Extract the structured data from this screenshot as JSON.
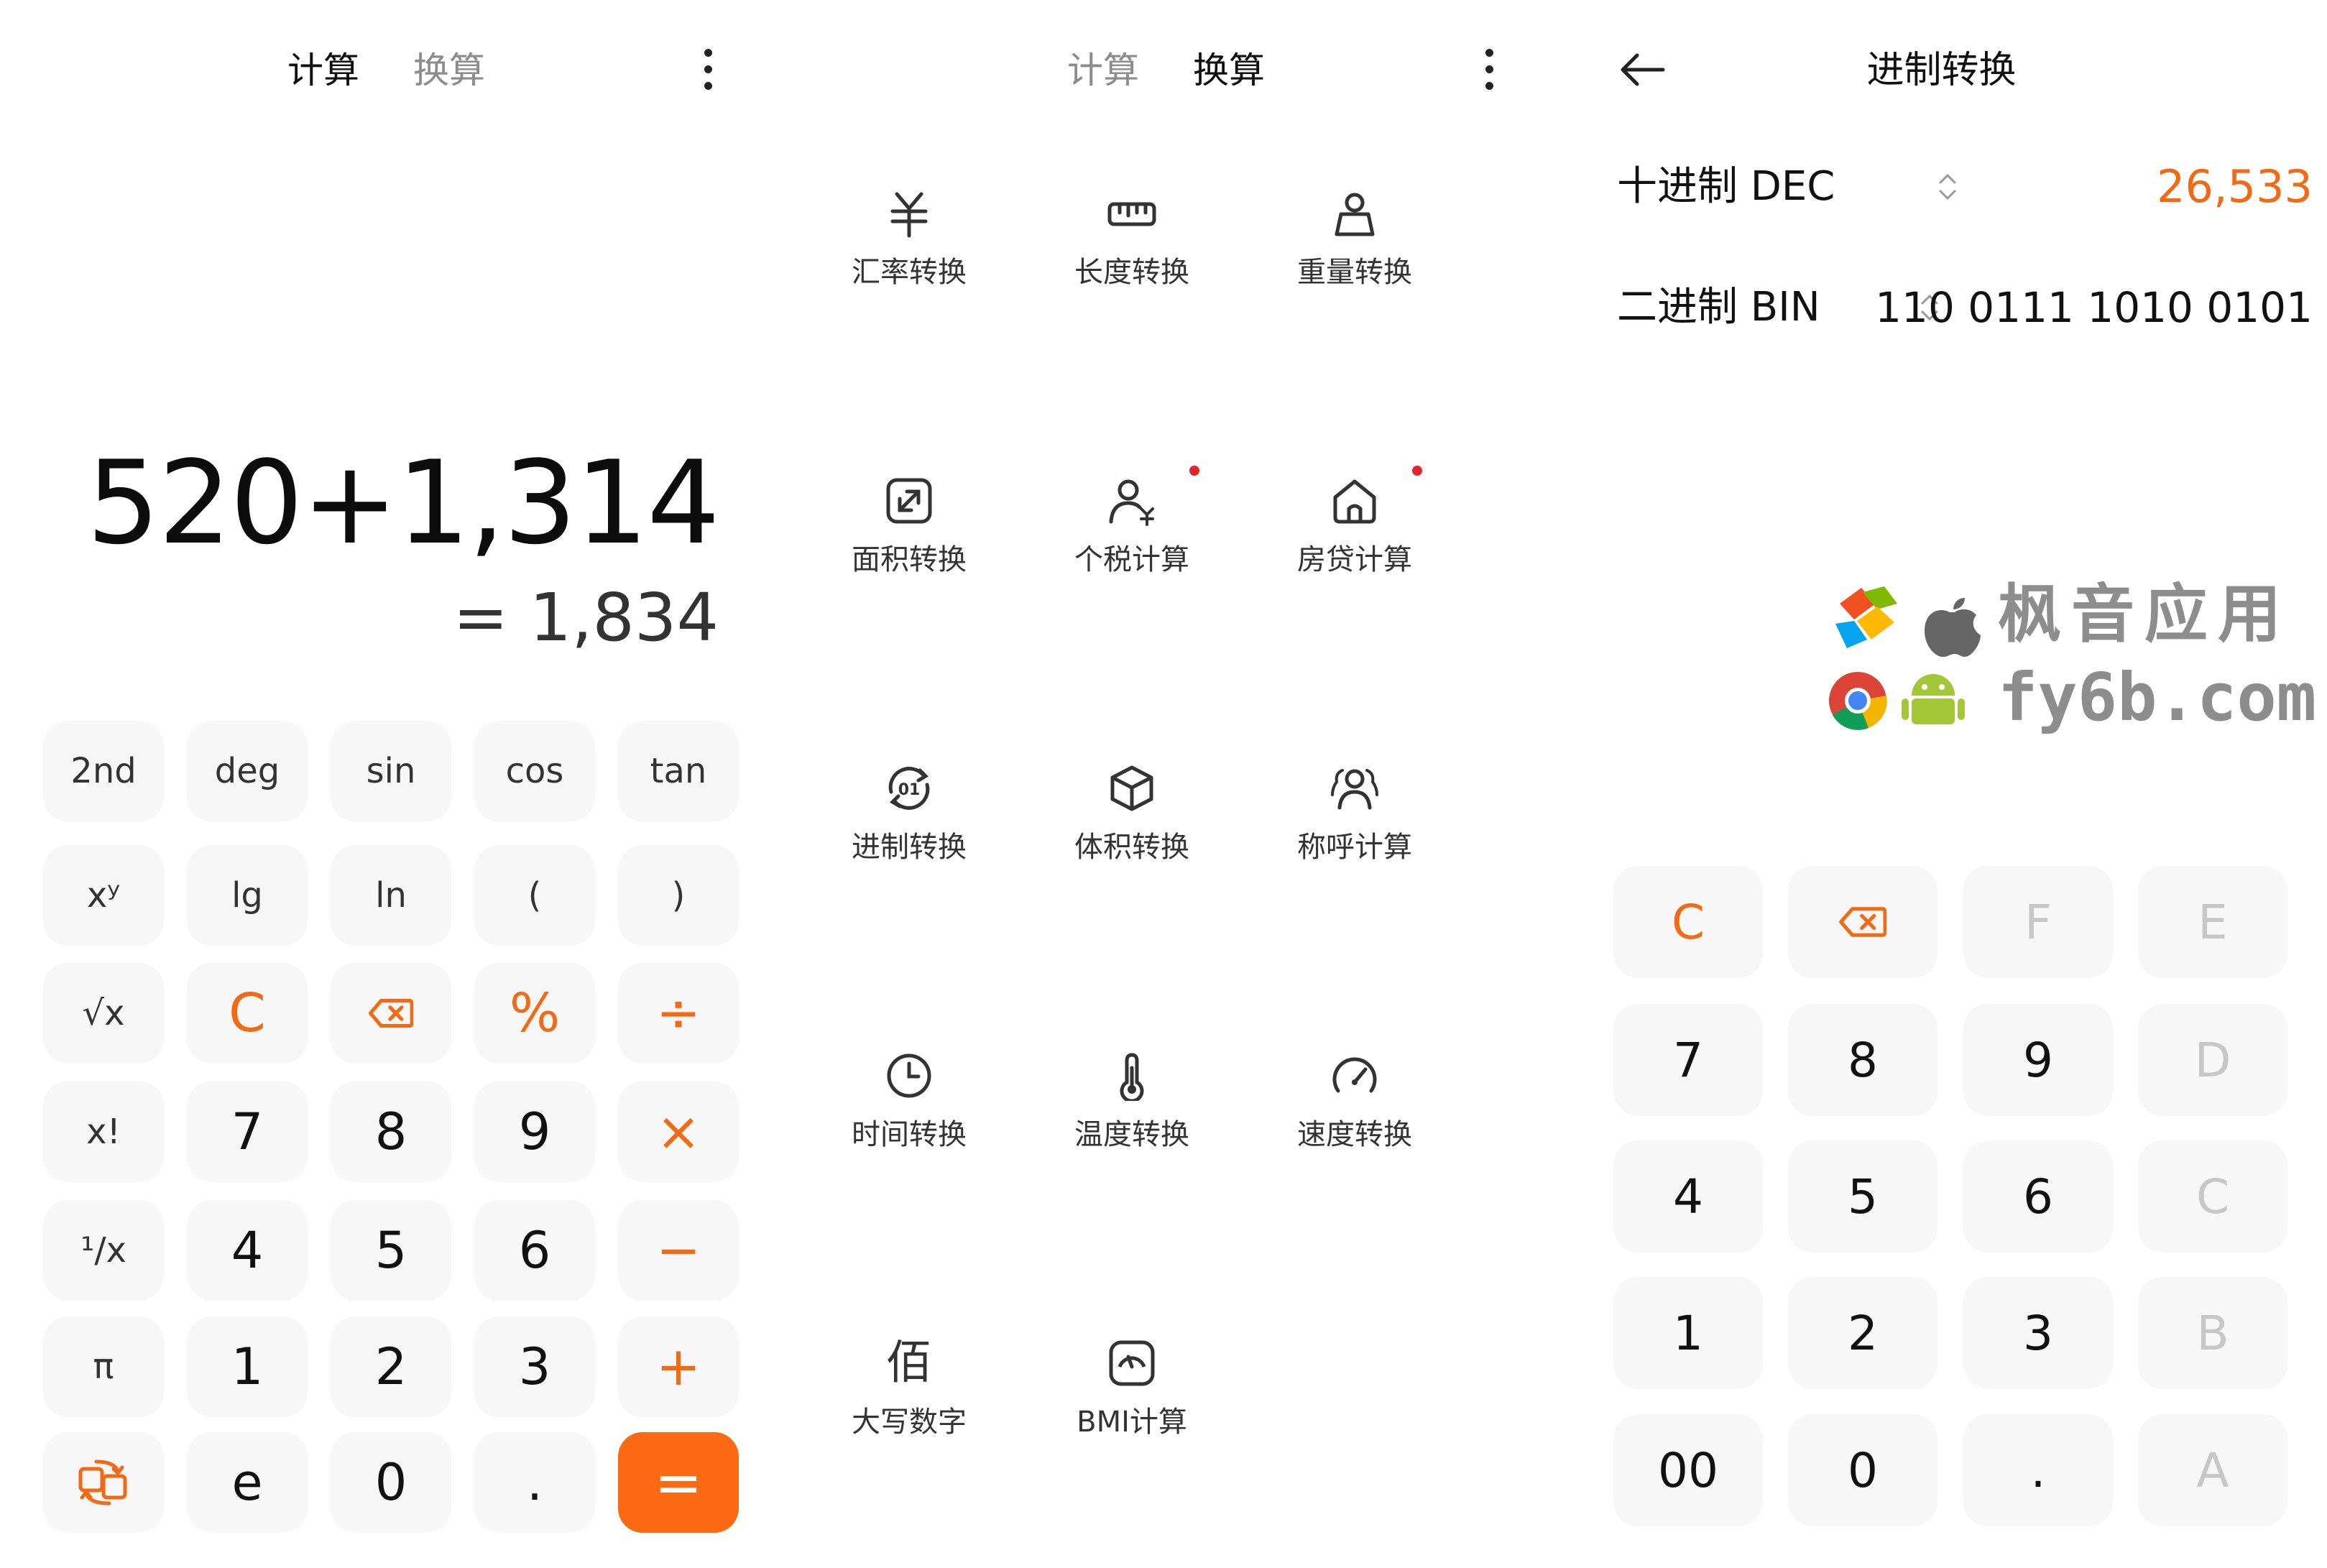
{
  "calc": {
    "tabs": [
      "计算",
      "换算"
    ],
    "expression": "520+1,314",
    "result": "= 1,834",
    "keys": [
      [
        "2nd",
        "deg",
        "sin",
        "cos",
        "tan"
      ],
      [
        "xʸ",
        "lg",
        "ln",
        "(",
        ")"
      ],
      [
        "√x",
        "C",
        "backspace",
        "%",
        "÷"
      ],
      [
        "x!",
        "7",
        "8",
        "9",
        "×"
      ],
      [
        "¹/x",
        "4",
        "5",
        "6",
        "−"
      ],
      [
        "π",
        "1",
        "2",
        "3",
        "+"
      ],
      [
        "switch",
        "e",
        "0",
        ".",
        "="
      ]
    ]
  },
  "convert": {
    "tabs": [
      "计算",
      "换算"
    ],
    "tools": [
      {
        "label": "汇率转换",
        "icon": "yuan-icon",
        "dot": false
      },
      {
        "label": "长度转换",
        "icon": "ruler-icon",
        "dot": false
      },
      {
        "label": "重量转换",
        "icon": "weight-icon",
        "dot": false
      },
      {
        "label": "面积转换",
        "icon": "area-icon",
        "dot": false
      },
      {
        "label": "个税计算",
        "icon": "tax-icon",
        "dot": true
      },
      {
        "label": "房贷计算",
        "icon": "house-icon",
        "dot": true
      },
      {
        "label": "进制转换",
        "icon": "base-icon",
        "dot": false
      },
      {
        "label": "体积转换",
        "icon": "cube-icon",
        "dot": false
      },
      {
        "label": "称呼计算",
        "icon": "people-icon",
        "dot": false
      },
      {
        "label": "时间转换",
        "icon": "clock-icon",
        "dot": false
      },
      {
        "label": "温度转换",
        "icon": "thermometer-icon",
        "dot": false
      },
      {
        "label": "速度转换",
        "icon": "speed-icon",
        "dot": false
      },
      {
        "label": "大写数字",
        "icon": "bai-icon",
        "dot": false
      },
      {
        "label": "BMI计算",
        "icon": "bmi-icon",
        "dot": false
      }
    ],
    "bai_glyph": "佰"
  },
  "base": {
    "title": "进制转换",
    "rows": [
      {
        "name": "十进制 DEC",
        "value": "26,533",
        "active": true
      },
      {
        "name": "二进制 BIN",
        "value": "110 0111 1010 0101",
        "active": false
      }
    ],
    "keys": [
      [
        "C",
        "backspace",
        "F",
        "E"
      ],
      [
        "7",
        "8",
        "9",
        "D"
      ],
      [
        "4",
        "5",
        "6",
        "C"
      ],
      [
        "1",
        "2",
        "3",
        "B"
      ],
      [
        "00",
        "0",
        ".",
        "A"
      ]
    ],
    "disabled": [
      "F",
      "E",
      "D",
      "C",
      "B",
      "A"
    ]
  },
  "watermark": {
    "line1": "枫音应用",
    "line2": "fy6b.com"
  },
  "colors": {
    "accent": "#f26a13",
    "accent_fill": "#fb6a12",
    "key_bg": "#f7f7f7",
    "badge_red": "#e4242b",
    "disabled": "#c7c7c7"
  }
}
